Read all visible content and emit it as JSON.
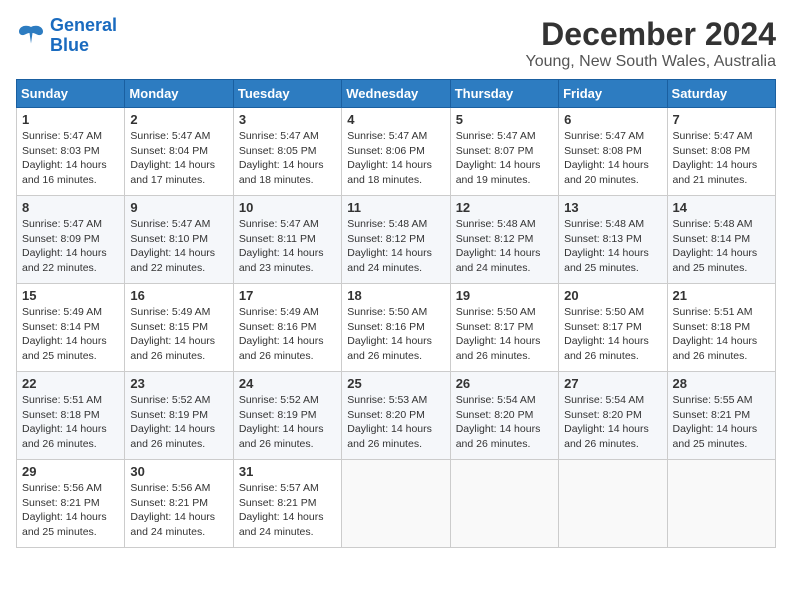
{
  "header": {
    "logo_line1": "General",
    "logo_line2": "Blue",
    "title": "December 2024",
    "subtitle": "Young, New South Wales, Australia"
  },
  "calendar": {
    "days_of_week": [
      "Sunday",
      "Monday",
      "Tuesday",
      "Wednesday",
      "Thursday",
      "Friday",
      "Saturday"
    ],
    "weeks": [
      [
        null,
        {
          "day": 2,
          "sunrise": "5:47 AM",
          "sunset": "8:04 PM",
          "daylight": "14 hours and 17 minutes."
        },
        {
          "day": 3,
          "sunrise": "5:47 AM",
          "sunset": "8:05 PM",
          "daylight": "14 hours and 18 minutes."
        },
        {
          "day": 4,
          "sunrise": "5:47 AM",
          "sunset": "8:06 PM",
          "daylight": "14 hours and 18 minutes."
        },
        {
          "day": 5,
          "sunrise": "5:47 AM",
          "sunset": "8:07 PM",
          "daylight": "14 hours and 19 minutes."
        },
        {
          "day": 6,
          "sunrise": "5:47 AM",
          "sunset": "8:08 PM",
          "daylight": "14 hours and 20 minutes."
        },
        {
          "day": 7,
          "sunrise": "5:47 AM",
          "sunset": "8:08 PM",
          "daylight": "14 hours and 21 minutes."
        }
      ],
      [
        {
          "day": 8,
          "sunrise": "5:47 AM",
          "sunset": "8:09 PM",
          "daylight": "14 hours and 22 minutes."
        },
        {
          "day": 9,
          "sunrise": "5:47 AM",
          "sunset": "8:10 PM",
          "daylight": "14 hours and 22 minutes."
        },
        {
          "day": 10,
          "sunrise": "5:47 AM",
          "sunset": "8:11 PM",
          "daylight": "14 hours and 23 minutes."
        },
        {
          "day": 11,
          "sunrise": "5:48 AM",
          "sunset": "8:12 PM",
          "daylight": "14 hours and 24 minutes."
        },
        {
          "day": 12,
          "sunrise": "5:48 AM",
          "sunset": "8:12 PM",
          "daylight": "14 hours and 24 minutes."
        },
        {
          "day": 13,
          "sunrise": "5:48 AM",
          "sunset": "8:13 PM",
          "daylight": "14 hours and 25 minutes."
        },
        {
          "day": 14,
          "sunrise": "5:48 AM",
          "sunset": "8:14 PM",
          "daylight": "14 hours and 25 minutes."
        }
      ],
      [
        {
          "day": 15,
          "sunrise": "5:49 AM",
          "sunset": "8:14 PM",
          "daylight": "14 hours and 25 minutes."
        },
        {
          "day": 16,
          "sunrise": "5:49 AM",
          "sunset": "8:15 PM",
          "daylight": "14 hours and 26 minutes."
        },
        {
          "day": 17,
          "sunrise": "5:49 AM",
          "sunset": "8:16 PM",
          "daylight": "14 hours and 26 minutes."
        },
        {
          "day": 18,
          "sunrise": "5:50 AM",
          "sunset": "8:16 PM",
          "daylight": "14 hours and 26 minutes."
        },
        {
          "day": 19,
          "sunrise": "5:50 AM",
          "sunset": "8:17 PM",
          "daylight": "14 hours and 26 minutes."
        },
        {
          "day": 20,
          "sunrise": "5:50 AM",
          "sunset": "8:17 PM",
          "daylight": "14 hours and 26 minutes."
        },
        {
          "day": 21,
          "sunrise": "5:51 AM",
          "sunset": "8:18 PM",
          "daylight": "14 hours and 26 minutes."
        }
      ],
      [
        {
          "day": 22,
          "sunrise": "5:51 AM",
          "sunset": "8:18 PM",
          "daylight": "14 hours and 26 minutes."
        },
        {
          "day": 23,
          "sunrise": "5:52 AM",
          "sunset": "8:19 PM",
          "daylight": "14 hours and 26 minutes."
        },
        {
          "day": 24,
          "sunrise": "5:52 AM",
          "sunset": "8:19 PM",
          "daylight": "14 hours and 26 minutes."
        },
        {
          "day": 25,
          "sunrise": "5:53 AM",
          "sunset": "8:20 PM",
          "daylight": "14 hours and 26 minutes."
        },
        {
          "day": 26,
          "sunrise": "5:54 AM",
          "sunset": "8:20 PM",
          "daylight": "14 hours and 26 minutes."
        },
        {
          "day": 27,
          "sunrise": "5:54 AM",
          "sunset": "8:20 PM",
          "daylight": "14 hours and 26 minutes."
        },
        {
          "day": 28,
          "sunrise": "5:55 AM",
          "sunset": "8:21 PM",
          "daylight": "14 hours and 25 minutes."
        }
      ],
      [
        {
          "day": 29,
          "sunrise": "5:56 AM",
          "sunset": "8:21 PM",
          "daylight": "14 hours and 25 minutes."
        },
        {
          "day": 30,
          "sunrise": "5:56 AM",
          "sunset": "8:21 PM",
          "daylight": "14 hours and 24 minutes."
        },
        {
          "day": 31,
          "sunrise": "5:57 AM",
          "sunset": "8:21 PM",
          "daylight": "14 hours and 24 minutes."
        },
        null,
        null,
        null,
        null
      ]
    ],
    "week0_day1": {
      "day": 1,
      "sunrise": "5:47 AM",
      "sunset": "8:03 PM",
      "daylight": "14 hours and 16 minutes."
    }
  }
}
